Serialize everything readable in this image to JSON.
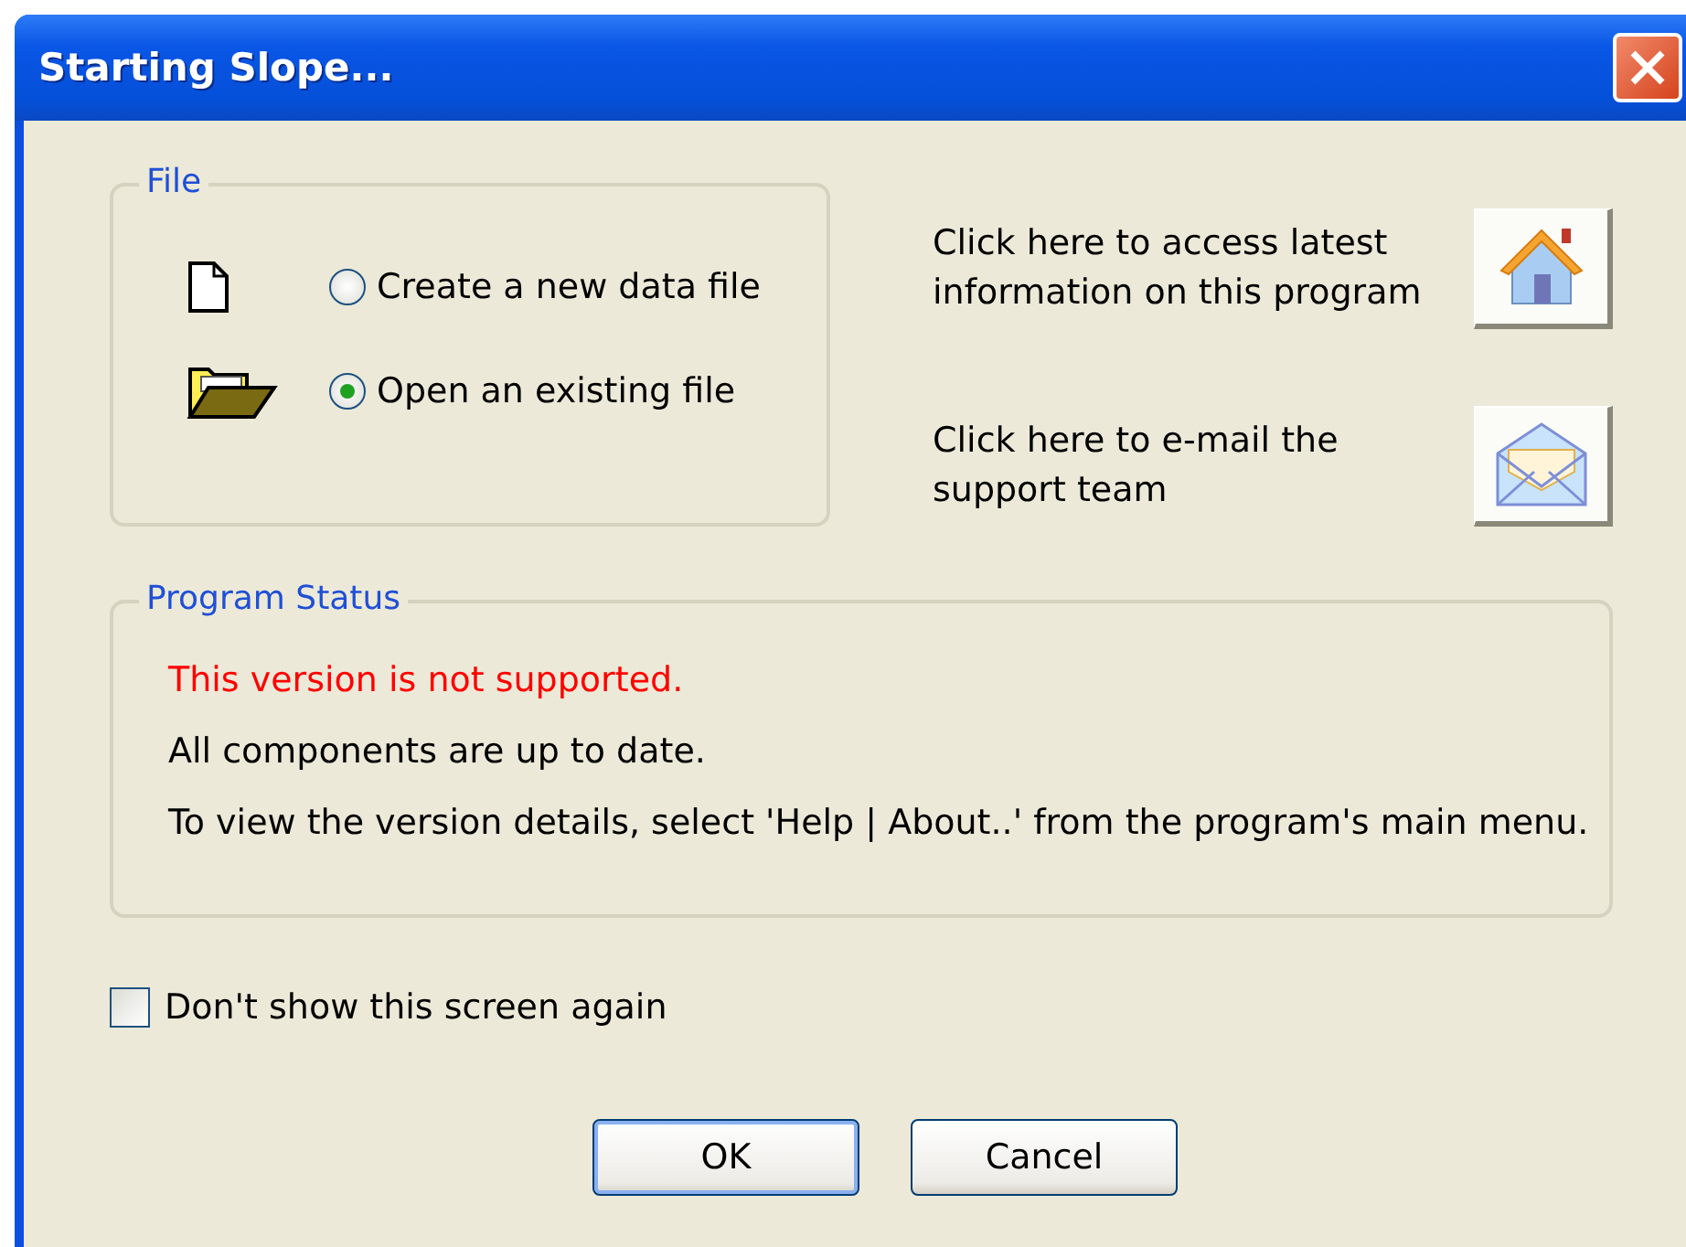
{
  "window": {
    "title": "Starting Slope..."
  },
  "file_group": {
    "title": "File",
    "options": [
      {
        "label": "Create a new data file",
        "kind": "new",
        "selected": false
      },
      {
        "label": "Open an existing file",
        "kind": "open",
        "selected": true
      }
    ]
  },
  "links": [
    {
      "text": "Click here to access latest information on this program",
      "kind": "home"
    },
    {
      "text": "Click here to e-mail the support team",
      "kind": "mail"
    }
  ],
  "status_group": {
    "title": "Program Status",
    "messages": [
      {
        "text": "This version is not supported.",
        "kind": "error"
      },
      {
        "text": "All components are up to date.",
        "kind": "normal"
      },
      {
        "text": "To view the version details, select 'Help | About..' from the program's main menu.",
        "kind": "normal"
      }
    ]
  },
  "dont_show": {
    "label": "Don't show this screen again",
    "checked": false
  },
  "buttons": [
    {
      "label": "OK",
      "default": true
    },
    {
      "label": "Cancel",
      "default": false
    }
  ]
}
